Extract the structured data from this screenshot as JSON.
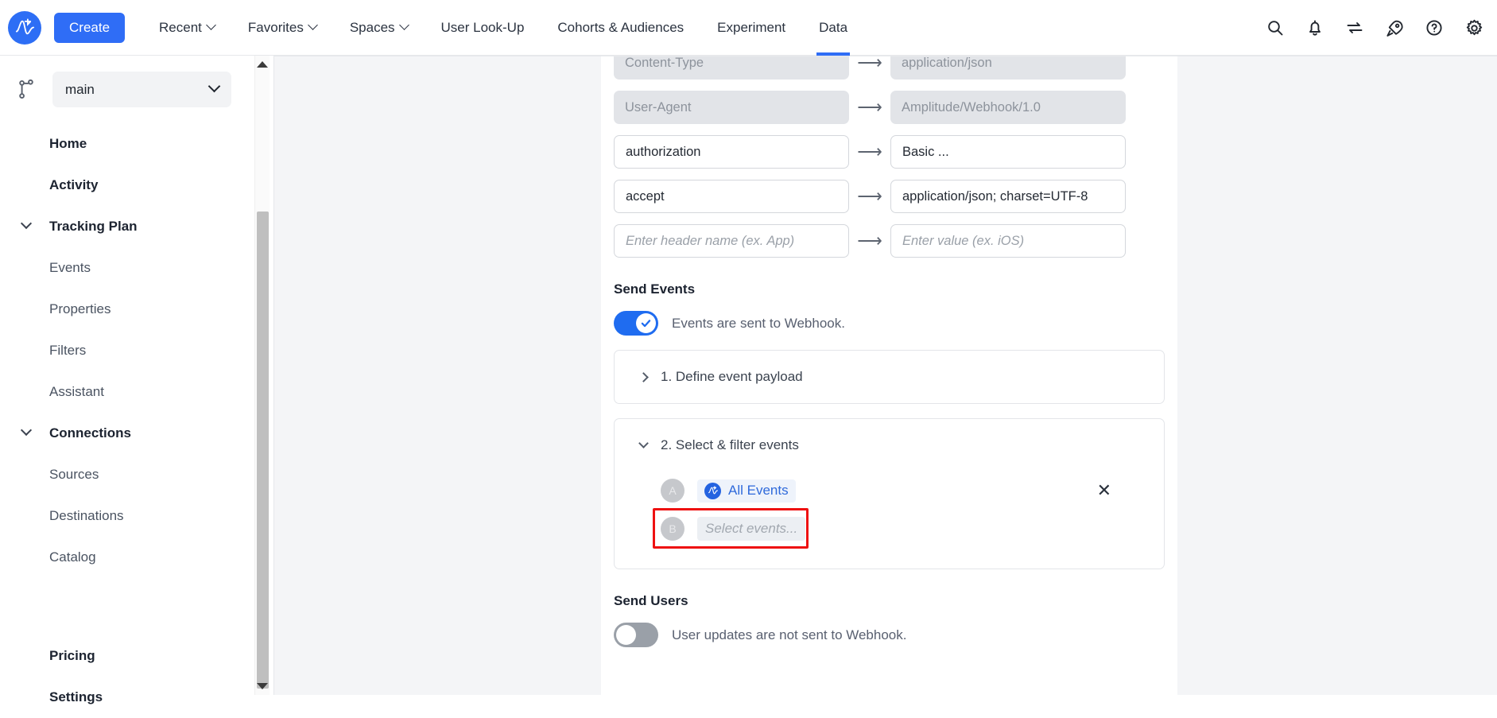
{
  "topbar": {
    "logo_name": "amplitude-logo",
    "create_label": "Create",
    "nav": [
      {
        "label": "Recent",
        "caret": true,
        "active": false
      },
      {
        "label": "Favorites",
        "caret": true,
        "active": false
      },
      {
        "label": "Spaces",
        "caret": true,
        "active": false
      },
      {
        "label": "User Look-Up",
        "caret": false,
        "active": false
      },
      {
        "label": "Cohorts & Audiences",
        "caret": false,
        "active": false
      },
      {
        "label": "Experiment",
        "caret": false,
        "active": false
      },
      {
        "label": "Data",
        "caret": false,
        "active": true
      }
    ],
    "icons": [
      "search-icon",
      "bell-icon",
      "swap-arrows-icon",
      "rocket-icon",
      "help-circle-icon",
      "gear-icon"
    ]
  },
  "sidebar": {
    "branch_icon": "git-branch-icon",
    "branch_value": "main",
    "items": [
      {
        "label": "Home",
        "style": "bold",
        "chevron": false,
        "sub": false
      },
      {
        "label": "Activity",
        "style": "bold",
        "chevron": false,
        "sub": false
      },
      {
        "label": "Tracking Plan",
        "style": "bold",
        "chevron": true,
        "sub": false
      },
      {
        "label": "Events",
        "style": "plain",
        "chevron": false,
        "sub": true
      },
      {
        "label": "Properties",
        "style": "plain",
        "chevron": false,
        "sub": true
      },
      {
        "label": "Filters",
        "style": "plain",
        "chevron": false,
        "sub": true
      },
      {
        "label": "Assistant",
        "style": "plain",
        "chevron": false,
        "sub": true
      },
      {
        "label": "Connections",
        "style": "bold",
        "chevron": true,
        "sub": false
      },
      {
        "label": "Sources",
        "style": "plain",
        "chevron": false,
        "sub": true
      },
      {
        "label": "Destinations",
        "style": "plain",
        "chevron": false,
        "sub": true
      },
      {
        "label": "Catalog",
        "style": "plain",
        "chevron": false,
        "sub": true
      }
    ],
    "footer_items": [
      {
        "label": "Pricing",
        "style": "bold"
      },
      {
        "label": "Settings",
        "style": "bold"
      }
    ]
  },
  "main": {
    "headers": [
      {
        "key": "Content-Type",
        "value": "application/json",
        "disabled": true,
        "key_ph": false,
        "val_ph": false
      },
      {
        "key": "User-Agent",
        "value": "Amplitude/Webhook/1.0",
        "disabled": true,
        "key_ph": false,
        "val_ph": false
      },
      {
        "key": "authorization",
        "value": "Basic ...",
        "disabled": false,
        "key_ph": false,
        "val_ph": false
      },
      {
        "key": "accept",
        "value": "application/json; charset=UTF-8",
        "disabled": false,
        "key_ph": false,
        "val_ph": false
      },
      {
        "key": "Enter header name (ex. App)",
        "value": "Enter value (ex. iOS)",
        "disabled": false,
        "key_ph": true,
        "val_ph": true
      }
    ],
    "arrow_glyph": "⟶",
    "send_events": {
      "title": "Send Events",
      "toggle_state": "on",
      "toggle_label": "Events are sent to Webhook.",
      "step1": {
        "label": "1. Define event payload",
        "expanded": false
      },
      "step2": {
        "label": "2. Select & filter events",
        "expanded": true,
        "rows": [
          {
            "badge": "A",
            "text": "All Events",
            "placeholder": false,
            "icon": "amplitude-event-icon",
            "has_close": true,
            "highlighted": true
          },
          {
            "badge": "B",
            "text": "Select events...",
            "placeholder": true,
            "icon": null,
            "has_close": false,
            "highlighted": false
          }
        ],
        "close_glyph": "✕"
      }
    },
    "send_users": {
      "title": "Send Users",
      "toggle_state": "off",
      "toggle_label": "User updates are not sent to Webhook."
    }
  },
  "colors": {
    "accent": "#2f6df6",
    "highlight": "#ee1111",
    "chip_text": "#2f6adb",
    "panel_bg": "#ffffff",
    "page_bg": "#f4f5f7"
  }
}
